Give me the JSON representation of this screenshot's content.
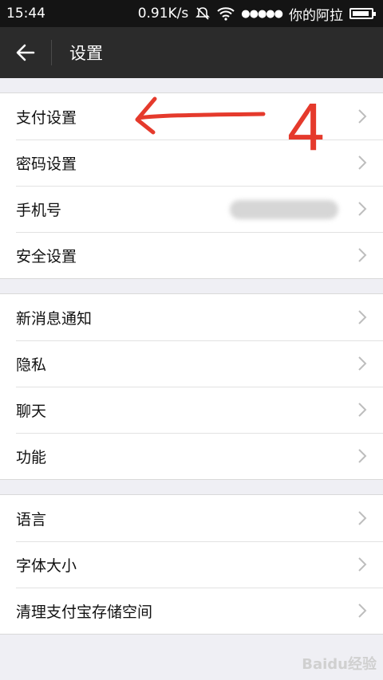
{
  "status_bar": {
    "time": "15:44",
    "speed": "0.91K/s",
    "carrier": "你的阿拉",
    "signal": "●●●●●"
  },
  "header": {
    "title": "设置"
  },
  "groups": [
    {
      "items": [
        {
          "label": "支付设置"
        },
        {
          "label": "密码设置"
        },
        {
          "label": "手机号"
        },
        {
          "label": "安全设置"
        }
      ]
    },
    {
      "items": [
        {
          "label": "新消息通知"
        },
        {
          "label": "隐私"
        },
        {
          "label": "聊天"
        },
        {
          "label": "功能"
        }
      ]
    },
    {
      "items": [
        {
          "label": "语言"
        },
        {
          "label": "字体大小"
        },
        {
          "label": "清理支付宝存储空间"
        }
      ]
    }
  ],
  "annotation": {
    "number": "4",
    "color": "#e53a2c"
  },
  "watermark": "Baidu经验"
}
